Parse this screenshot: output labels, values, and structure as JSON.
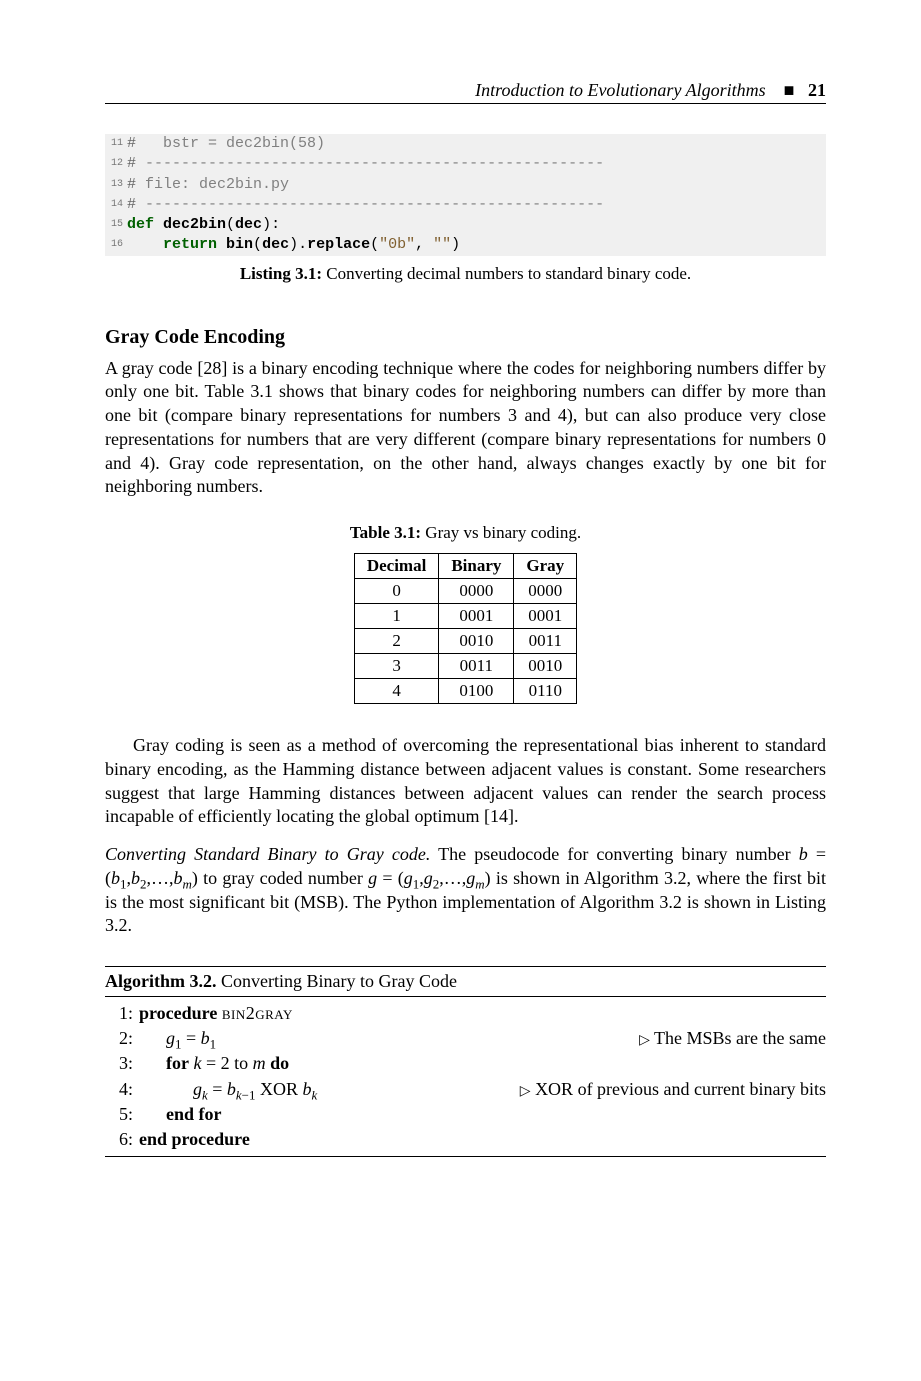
{
  "header": {
    "text": "Introduction to Evolutionary Algorithms",
    "page_number": "21"
  },
  "listing": {
    "lines": [
      {
        "n": "11",
        "seg": [
          {
            "cls": "gut",
            "t": "#   "
          },
          {
            "cls": "comment",
            "t": "bstr = dec2bin(58)"
          }
        ]
      },
      {
        "n": "12",
        "seg": [
          {
            "cls": "gut",
            "t": "# "
          },
          {
            "cls": "comment",
            "t": "---------------------------------------------------"
          }
        ]
      },
      {
        "n": "13",
        "seg": [
          {
            "cls": "gut",
            "t": "# "
          },
          {
            "cls": "comment",
            "t": "file: dec2bin.py"
          }
        ]
      },
      {
        "n": "14",
        "seg": [
          {
            "cls": "gut",
            "t": "# "
          },
          {
            "cls": "comment",
            "t": "---------------------------------------------------"
          }
        ]
      },
      {
        "n": "15",
        "seg": [
          {
            "cls": "kw",
            "t": "def "
          },
          {
            "cls": "call",
            "t": "dec2bin"
          },
          {
            "cls": "",
            "t": "("
          },
          {
            "cls": "call",
            "t": "dec"
          },
          {
            "cls": "",
            "t": "):"
          }
        ]
      },
      {
        "n": "16",
        "seg": [
          {
            "cls": "",
            "t": "    "
          },
          {
            "cls": "kw",
            "t": "return "
          },
          {
            "cls": "call",
            "t": "bin"
          },
          {
            "cls": "",
            "t": "("
          },
          {
            "cls": "call",
            "t": "dec"
          },
          {
            "cls": "",
            "t": ")."
          },
          {
            "cls": "call",
            "t": "replace"
          },
          {
            "cls": "",
            "t": "("
          },
          {
            "cls": "str",
            "t": "\"0b\""
          },
          {
            "cls": "",
            "t": ", "
          },
          {
            "cls": "str",
            "t": "\"\""
          },
          {
            "cls": "",
            "t": ")"
          }
        ]
      }
    ],
    "caption_label": "Listing 3.1:",
    "caption_text": " Converting decimal numbers to standard binary code."
  },
  "section_heading": "Gray Code Encoding",
  "para1": "A gray code [28] is a binary encoding technique where the codes for neighboring numbers differ by only one bit. Table 3.1 shows that binary codes for neighboring numbers can differ by more than one bit (compare binary representations for numbers 3 and 4), but can also produce very close representations for numbers that are very different (compare binary representations for numbers 0 and 4). Gray code representation, on the other hand, always changes exactly by one bit for neighboring numbers.",
  "table": {
    "caption_label": "Table 3.1:",
    "caption_text": " Gray vs binary coding.",
    "headers": [
      "Decimal",
      "Binary",
      "Gray"
    ],
    "rows": [
      [
        "0",
        "0000",
        "0000"
      ],
      [
        "1",
        "0001",
        "0001"
      ],
      [
        "2",
        "0010",
        "0011"
      ],
      [
        "3",
        "0011",
        "0010"
      ],
      [
        "4",
        "0100",
        "0110"
      ]
    ]
  },
  "para2": "Gray coding is seen as a method of overcoming the representational bias inherent to standard binary encoding, as the Hamming distance between adjacent values is constant. Some researchers suggest that large Hamming distances between adjacent values can render the search process incapable of efficiently locating the global optimum [14].",
  "para3_runin": "Converting Standard Binary to Gray code.",
  "para3_a": " The pseudocode for converting binary number ",
  "para3_b": " to gray coded number ",
  "para3_c": " is shown in Algorithm 3.2, where the first bit is the most significant bit (MSB). The Python implementation of Algorithm 3.2 is shown in Listing 3.2.",
  "algo": {
    "title_label": "Algorithm 3.2.",
    "title_text": " Converting Binary to Gray Code",
    "lines": [
      {
        "n": "1:",
        "indent": 0,
        "content_html": "<b>procedure</b> <span class=\"sc\">bin2gray</span>"
      },
      {
        "n": "2:",
        "indent": 1,
        "content_html": "<i>g</i><span class=\"sub\">1</span> = <i>b</i><span class=\"sub\">1</span>",
        "comment": "The MSBs are the same"
      },
      {
        "n": "3:",
        "indent": 1,
        "content_html": "<b>for</b> <i>k</i> = 2 to <i>m</i> <b>do</b>"
      },
      {
        "n": "4:",
        "indent": 2,
        "content_html": "<i>g</i><span class=\"sub\"><i>k</i></span> = <i>b</i><span class=\"sub\"><i>k</i>−1</span> XOR <i>b</i><span class=\"sub\"><i>k</i></span>",
        "comment": "XOR of previous and current binary bits"
      },
      {
        "n": "5:",
        "indent": 1,
        "content_html": "<b>end for</b>"
      },
      {
        "n": "6:",
        "indent": 0,
        "content_html": "<b>end procedure</b>"
      }
    ]
  }
}
